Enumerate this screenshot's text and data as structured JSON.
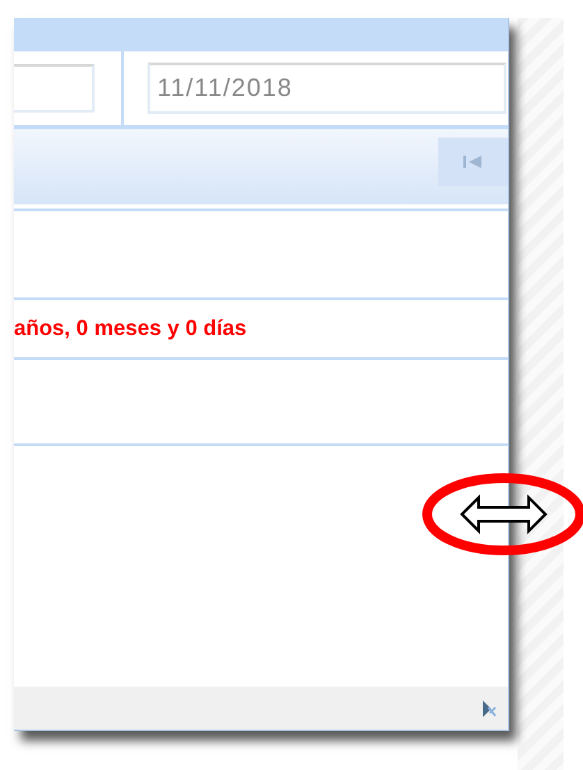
{
  "date_field": {
    "value": "11/11/2018"
  },
  "pager": {
    "first_button": {
      "disabled": true
    }
  },
  "result_text": "años, 0 meses y 0 días"
}
